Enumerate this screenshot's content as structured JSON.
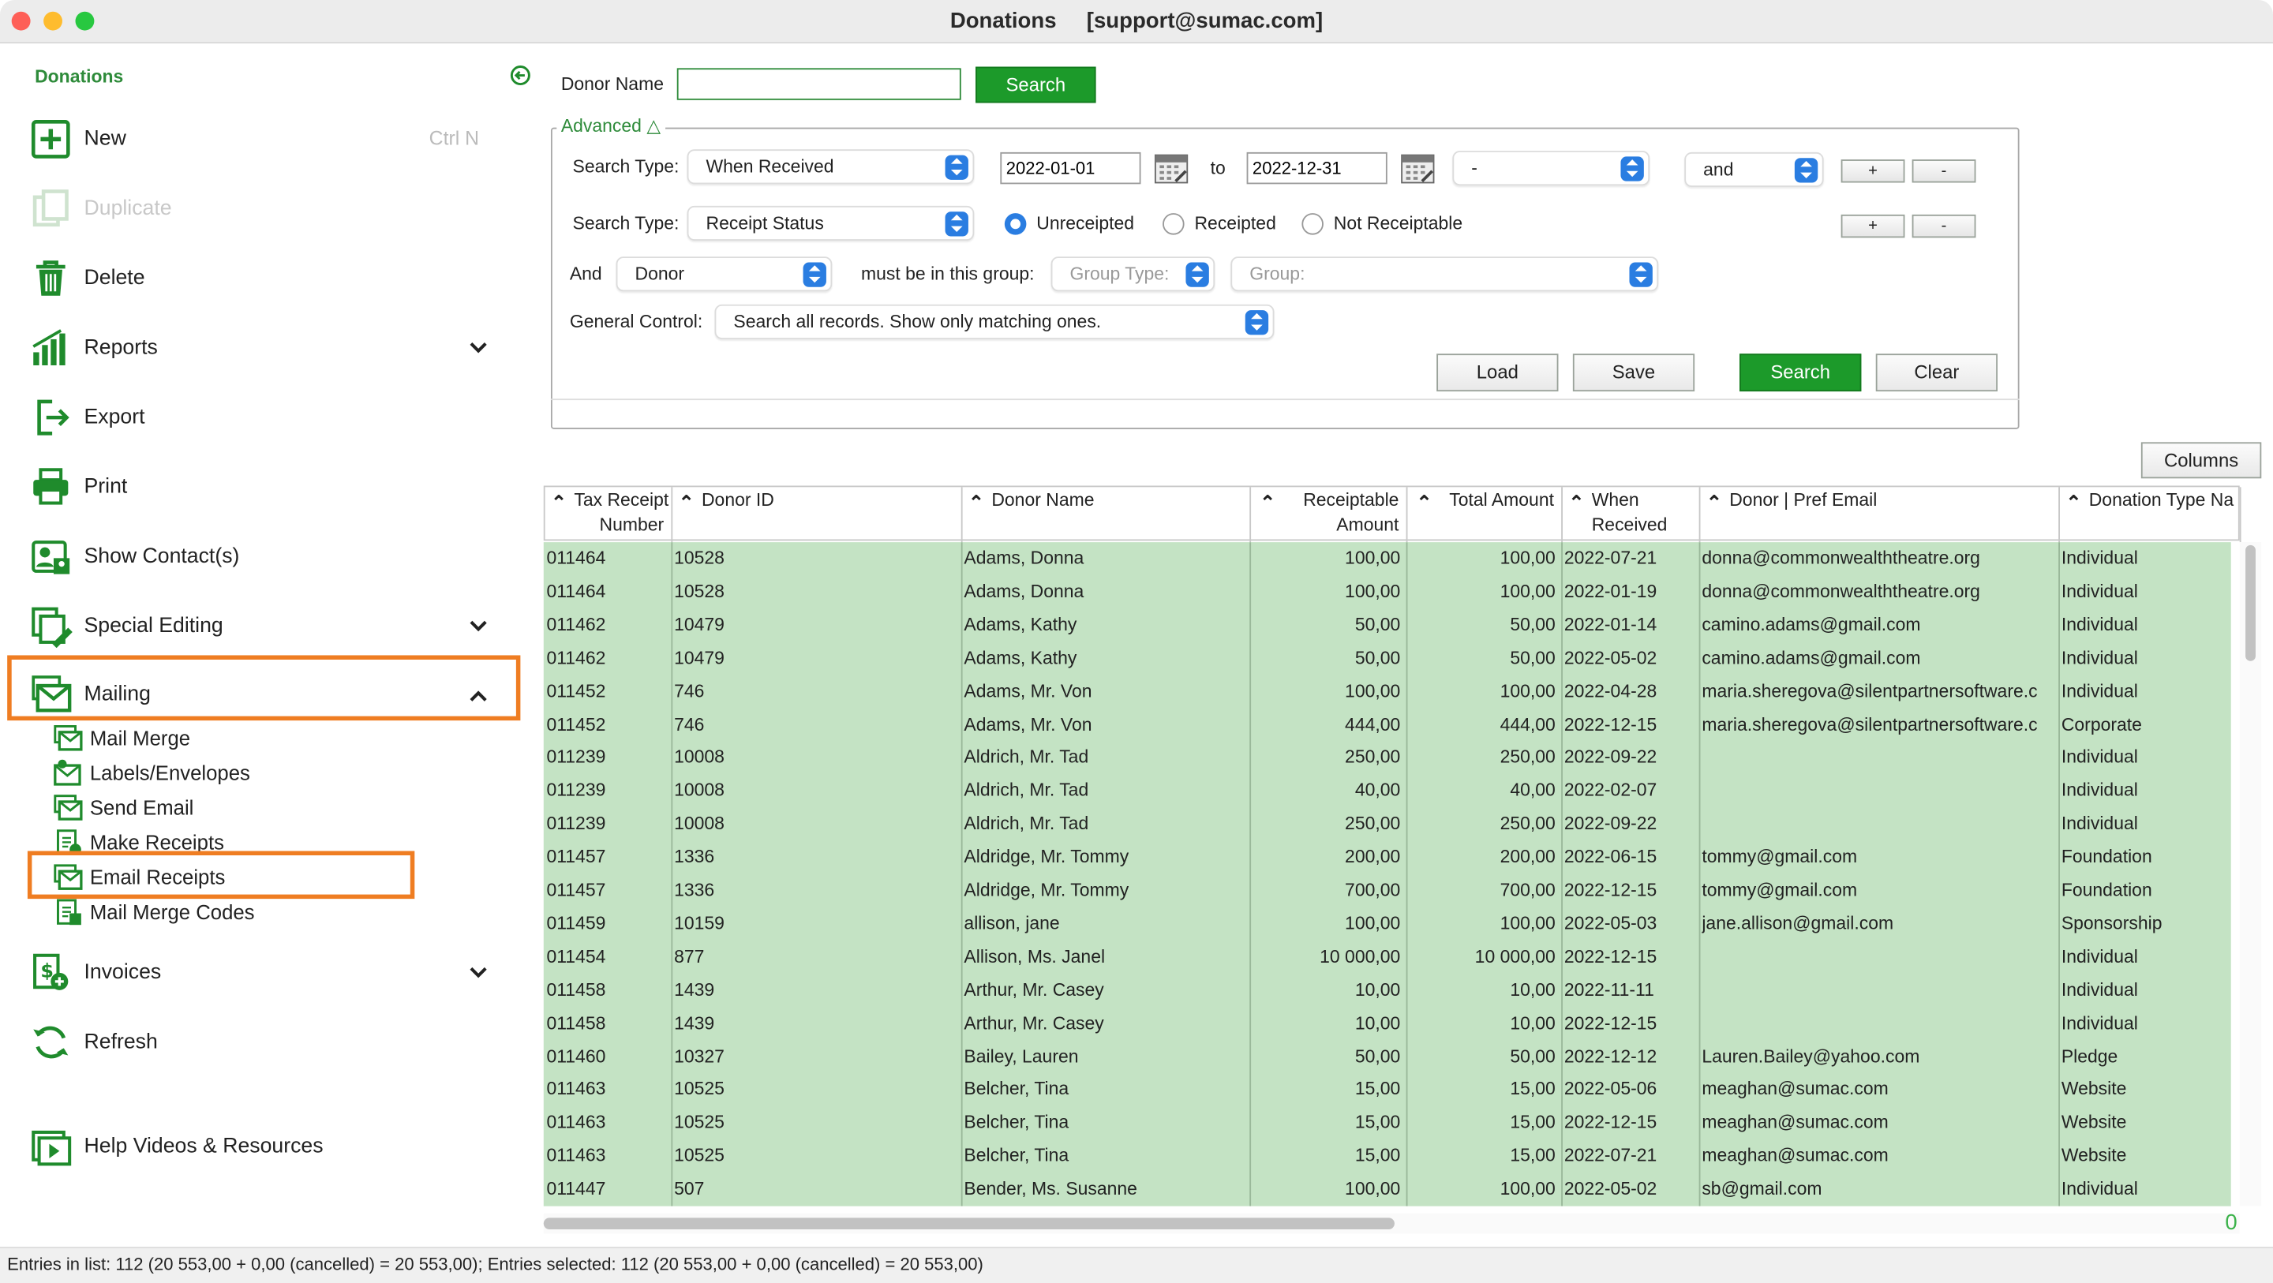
{
  "window": {
    "title": "Donations     [support@sumac.com]"
  },
  "sidebar": {
    "header": "Donations",
    "items": [
      {
        "label": "New",
        "shortcut": "Ctrl N",
        "icon": "plus-square-icon",
        "disabled": false
      },
      {
        "label": "Duplicate",
        "icon": "duplicate-icon",
        "disabled": true
      },
      {
        "label": "Delete",
        "icon": "trash-icon",
        "disabled": false
      },
      {
        "label": "Reports",
        "icon": "bar-chart-icon",
        "expandable": true
      },
      {
        "label": "Export",
        "icon": "export-icon"
      },
      {
        "label": "Print",
        "icon": "printer-icon"
      },
      {
        "label": "Show Contact(s)",
        "icon": "contacts-icon"
      },
      {
        "label": "Special Editing",
        "icon": "special-editing-icon",
        "expandable": true
      },
      {
        "label": "Mailing",
        "icon": "mail-icon",
        "expanded": true
      },
      {
        "label": "Invoices",
        "icon": "invoice-icon",
        "expandable": true
      },
      {
        "label": "Refresh",
        "icon": "refresh-icon"
      },
      {
        "label": "Help Videos & Resources",
        "icon": "video-icon"
      }
    ],
    "mailing_sub": [
      "Mail Merge",
      "Labels/Envelopes",
      "Send Email",
      "Make Receipts",
      "Email Receipts",
      "Mail Merge Codes"
    ]
  },
  "search": {
    "donor_name_label": "Donor Name",
    "donor_name_value": "",
    "search_button": "Search",
    "advanced_label": "Advanced",
    "row1": {
      "label": "Search Type:",
      "type": "When Received",
      "from": "2022-01-01",
      "to_label": "to",
      "to": "2022-12-31",
      "op": "-",
      "conj": "and"
    },
    "row2": {
      "label": "Search Type:",
      "type": "Receipt Status",
      "options": [
        "Unreceipted",
        "Receipted",
        "Not Receiptable"
      ],
      "selected": "Unreceipted"
    },
    "row3": {
      "and_label": "And",
      "entity": "Donor",
      "group_label": "must be in this group:",
      "group_type_placeholder": "Group Type:",
      "group_placeholder": "Group:"
    },
    "row4": {
      "label": "General Control:",
      "value": "Search all records. Show only matching ones."
    },
    "plus": "+",
    "minus": "-",
    "buttons": {
      "load": "Load",
      "save": "Save",
      "search": "Search",
      "clear": "Clear"
    },
    "columns_button": "Columns"
  },
  "table": {
    "headers": [
      {
        "line1": "Tax Receipt",
        "line2": "Number"
      },
      {
        "line1": "Donor ID",
        "line2": ""
      },
      {
        "line1": "Donor Name",
        "line2": ""
      },
      {
        "line1": "Receiptable",
        "line2": "Amount"
      },
      {
        "line1": "Total Amount",
        "line2": ""
      },
      {
        "line1": "When",
        "line2": "Received"
      },
      {
        "line1": "Donor | Pref Email",
        "line2": ""
      },
      {
        "line1": "Donation Type Na",
        "line2": ""
      }
    ],
    "rows": [
      [
        "011464",
        "10528",
        "Adams, Donna",
        "100,00",
        "100,00",
        "2022-07-21",
        "donna@commonwealththeatre.org",
        "Individual"
      ],
      [
        "011464",
        "10528",
        "Adams, Donna",
        "100,00",
        "100,00",
        "2022-01-19",
        "donna@commonwealththeatre.org",
        "Individual"
      ],
      [
        "011462",
        "10479",
        "Adams, Kathy",
        "50,00",
        "50,00",
        "2022-01-14",
        "camino.adams@gmail.com",
        "Individual"
      ],
      [
        "011462",
        "10479",
        "Adams, Kathy",
        "50,00",
        "50,00",
        "2022-05-02",
        "camino.adams@gmail.com",
        "Individual"
      ],
      [
        "011452",
        "746",
        "Adams, Mr. Von",
        "100,00",
        "100,00",
        "2022-04-28",
        "maria.sheregova@silentpartnersoftware.c",
        "Individual"
      ],
      [
        "011452",
        "746",
        "Adams, Mr. Von",
        "444,00",
        "444,00",
        "2022-12-15",
        "maria.sheregova@silentpartnersoftware.c",
        "Corporate"
      ],
      [
        "011239",
        "10008",
        "Aldrich, Mr. Tad",
        "250,00",
        "250,00",
        "2022-09-22",
        "",
        "Individual"
      ],
      [
        "011239",
        "10008",
        "Aldrich, Mr. Tad",
        "40,00",
        "40,00",
        "2022-02-07",
        "",
        "Individual"
      ],
      [
        "011239",
        "10008",
        "Aldrich, Mr. Tad",
        "250,00",
        "250,00",
        "2022-09-22",
        "",
        "Individual"
      ],
      [
        "011457",
        "1336",
        "Aldridge, Mr. Tommy",
        "200,00",
        "200,00",
        "2022-06-15",
        "tommy@gmail.com",
        "Foundation"
      ],
      [
        "011457",
        "1336",
        "Aldridge, Mr. Tommy",
        "700,00",
        "700,00",
        "2022-12-15",
        "tommy@gmail.com",
        "Foundation"
      ],
      [
        "011459",
        "10159",
        "allison, jane",
        "100,00",
        "100,00",
        "2022-05-03",
        "jane.allison@gmail.com",
        "Sponsorship"
      ],
      [
        "011454",
        "877",
        "Allison, Ms. Janel",
        "10 000,00",
        "10 000,00",
        "2022-12-15",
        "",
        "Individual"
      ],
      [
        "011458",
        "1439",
        "Arthur, Mr. Casey",
        "10,00",
        "10,00",
        "2022-11-11",
        "",
        "Individual"
      ],
      [
        "011458",
        "1439",
        "Arthur, Mr. Casey",
        "10,00",
        "10,00",
        "2022-12-15",
        "",
        "Individual"
      ],
      [
        "011460",
        "10327",
        "Bailey, Lauren",
        "50,00",
        "50,00",
        "2022-12-12",
        "Lauren.Bailey@yahoo.com",
        "Pledge"
      ],
      [
        "011463",
        "10525",
        "Belcher, Tina",
        "15,00",
        "15,00",
        "2022-05-06",
        "meaghan@sumac.com",
        "Website"
      ],
      [
        "011463",
        "10525",
        "Belcher, Tina",
        "15,00",
        "15,00",
        "2022-12-15",
        "meaghan@sumac.com",
        "Website"
      ],
      [
        "011463",
        "10525",
        "Belcher, Tina",
        "15,00",
        "15,00",
        "2022-07-21",
        "meaghan@sumac.com",
        "Website"
      ],
      [
        "011447",
        "507",
        "Bender, Ms. Susanne",
        "100,00",
        "100,00",
        "2022-05-02",
        "sb@gmail.com",
        "Individual"
      ]
    ],
    "corner_count": "0"
  },
  "status": "Entries in list: 112 (20 553,00 + 0,00 (cancelled) = 20 553,00); Entries selected: 112 (20 553,00 + 0,00 (cancelled) = 20 553,00)",
  "colors": {
    "accent_green": "#1c9a2a",
    "row_green": "#c4e3c4",
    "highlight_orange": "#ef7d22",
    "sidebar_header": "#2e8b3a"
  }
}
